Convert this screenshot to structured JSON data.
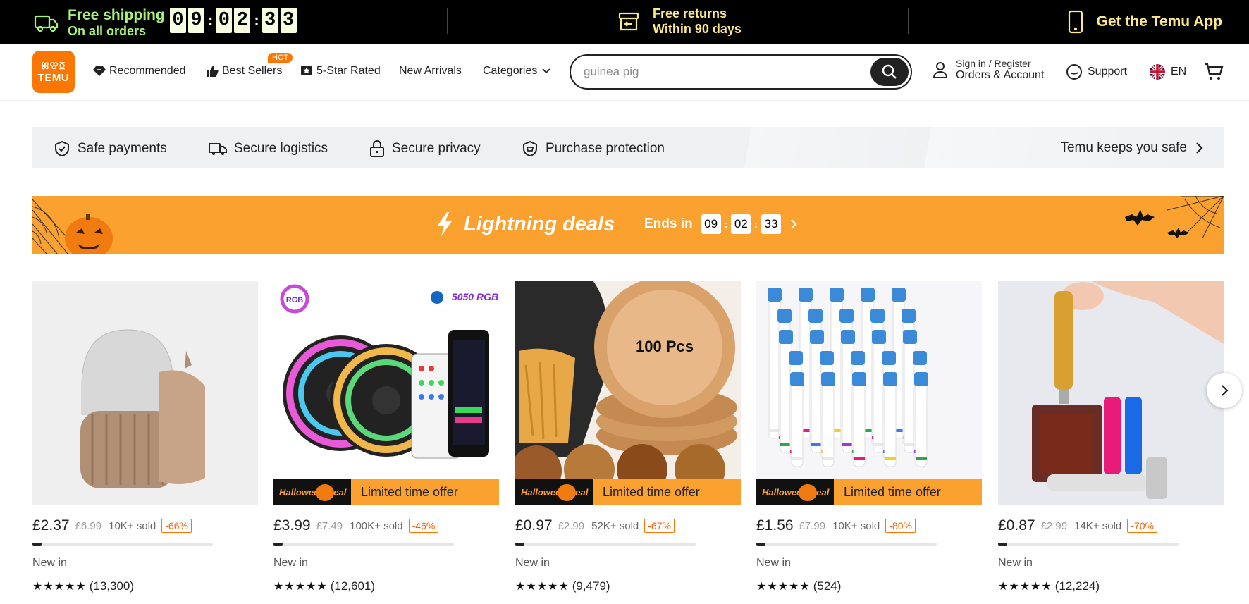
{
  "topbar": {
    "shipping_title": "Free shipping",
    "shipping_sub": "On all orders",
    "countdown": [
      "0",
      "9",
      "0",
      "2",
      "3",
      "3"
    ],
    "returns_title": "Free returns",
    "returns_sub": "Within 90 days",
    "app_label": "Get the Temu App"
  },
  "header": {
    "logo_top": "ꕤꕢꗞ",
    "logo_bottom": "TEMU",
    "nav": {
      "recommended": "Recommended",
      "best_sellers": "Best Sellers",
      "hot_badge": "HOT",
      "five_star": "5-Star Rated",
      "new_arrivals": "New Arrivals",
      "categories": "Categories"
    },
    "search": {
      "value": "guinea pig"
    },
    "account_top": "Sign in / Register",
    "account_bottom": "Orders & Account",
    "support": "Support",
    "language": "EN"
  },
  "safety": {
    "items": [
      "Safe payments",
      "Secure logistics",
      "Secure privacy",
      "Purchase protection"
    ],
    "right": "Temu keeps you safe"
  },
  "lightning": {
    "title": "Lightning deals",
    "ends_label": "Ends in",
    "hours": "09",
    "minutes": "02",
    "seconds": "33"
  },
  "products": [
    {
      "price": "£2.37",
      "old": "£6.99",
      "sold": "10K+ sold",
      "discount": "-66%",
      "progress": 0.05,
      "tag": "New in",
      "stars": "★★★★★",
      "reviews": "(13,300)",
      "limited": false,
      "kind": "ice-roller"
    },
    {
      "price": "£3.99",
      "old": "£7.49",
      "sold": "100K+ sold",
      "discount": "-46%",
      "progress": 0.05,
      "tag": "New in",
      "stars": "★★★★★",
      "reviews": "(12,601)",
      "limited": true,
      "limited_text": "Limited time offer",
      "deal_text": "Halloween Deal",
      "kind": "led-strip",
      "badge_rgb": "RGB",
      "badge_5050": "5050 RGB"
    },
    {
      "price": "£0.97",
      "old": "£2.99",
      "sold": "52K+ sold",
      "discount": "-67%",
      "progress": 0.05,
      "tag": "New in",
      "stars": "★★★★★",
      "reviews": "(9,479)",
      "limited": true,
      "limited_text": "Limited time offer",
      "deal_text": "Halloween Deal",
      "kind": "liners",
      "liner_text": "100 Pcs"
    },
    {
      "price": "£1.56",
      "old": "£7.99",
      "sold": "10K+ sold",
      "discount": "-80%",
      "progress": 0.05,
      "tag": "New in",
      "stars": "★★★★★",
      "reviews": "(524)",
      "limited": true,
      "limited_text": "Limited time offer",
      "deal_text": "Halloween Deal",
      "kind": "brush-heads"
    },
    {
      "price": "£0.87",
      "old": "£2.99",
      "sold": "14K+ sold",
      "discount": "-70%",
      "progress": 0.05,
      "tag": "New in",
      "stars": "★★★★★",
      "reviews": "(12,224)",
      "limited": false,
      "kind": "perfume"
    }
  ],
  "colors": {
    "brand": "#fb7701",
    "banner": "#fba130",
    "topbar_green": "#a8f27a",
    "topbar_yellow": "#fde98c"
  }
}
